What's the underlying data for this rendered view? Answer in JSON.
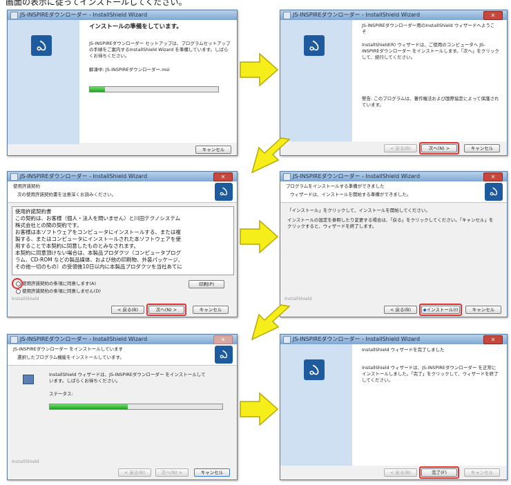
{
  "caption": "画面の表示に従ってインストールしてください。",
  "app_title": "JS-INSPIREダウンローダー - InstallShield Wizard",
  "close_label": "✕",
  "installshield_label": "InstallShield",
  "buttons": {
    "back": "< 戻る(B)",
    "next": "次へ(N) >",
    "cancel": "キャンセル",
    "install": "インストール(I)",
    "finish": "完了(F)",
    "print": "印刷(P)"
  },
  "w1": {
    "heading": "インストールの準備をしています。",
    "desc": "JS-INSPIREダウンローダー セットアップは、プログラムセットアップの手順をご案内するInstallShield Wizard を準備しています。しばらくお待ちください。",
    "status": "解凍中: JS-INSPIREダウンローダー.msi",
    "progress": 0.12
  },
  "w2": {
    "heading": "JS-INSPIREダウンローダー用のInstallShield ウィザードへようこそ",
    "desc": "InstallShield(R) ウィザードは、ご使用のコンピュータへ JS-INSPIREダウンローダー をインストールします。「次へ」をクリックして、続行してください。",
    "warning": "警告: このプログラムは、著作権法および国際協定によって保護されています。"
  },
  "w3": {
    "header_title": "使用許諾契約",
    "header_sub": "次の使用許諾契約書を注意深くお読みください。",
    "license_lines": [
      "使用許諾契約書",
      "この契約は、お客様（個人・法人を問いません）と川田テクノシステム",
      "株式会社との間の契約です。",
      "お客様は本ソフトウェアをコンピュータにインストールする、または複",
      "製する、またはコンピュータにインストールされた本ソフトウェアを使",
      "用することで本契約に同意したものとみなされます。",
      "本契約に同意頂けない場合は、本製品プロダクツ（コンピュータプログ",
      "ラム、CD-ROM などの製品媒体、および他の印刷物、外装パッケージ、",
      "その他一切のもの）の受領後10日以内に本製品プロダクツを当社あてに"
    ],
    "accept": "使用許諾契約の条項に同意します(A)",
    "decline": "使用許諾契約の条項に同意しません(D)"
  },
  "w4": {
    "header_title": "プログラムをインストールする準備ができました",
    "header_sub": "ウィザードは、インストールを開始する準備ができました。",
    "line1": "「インストール」をクリックして、インストールを開始してください。",
    "line2": "インストールの設定を参照したり変更する場合は、「戻る」をクリックしてください。「キャンセル」をクリックすると、ウィザードを終了します。"
  },
  "w5": {
    "header_title": "JS-INSPIREダウンローダー をインストールしています",
    "header_sub": "選択したプログラム機能をインストールしています。",
    "desc": "InstallShield ウィザードは、JS-INSPIREダウンローダー をインストールしています。しばらくお待ちください。",
    "status_label": "ステータス:",
    "progress": 0.45
  },
  "w6": {
    "heading": "InstallShield ウィザードを完了しました",
    "desc": "InstallShield ウィザードは、JS-INSPIREダウンローダー を正常にインストールしました。「完了」をクリックして、ウィザードを終了してください。"
  },
  "colors": {
    "arrow_fill": "#f5ee1a",
    "arrow_stroke": "#b8a800",
    "highlight": "#e03030",
    "progress": "#20a020"
  }
}
